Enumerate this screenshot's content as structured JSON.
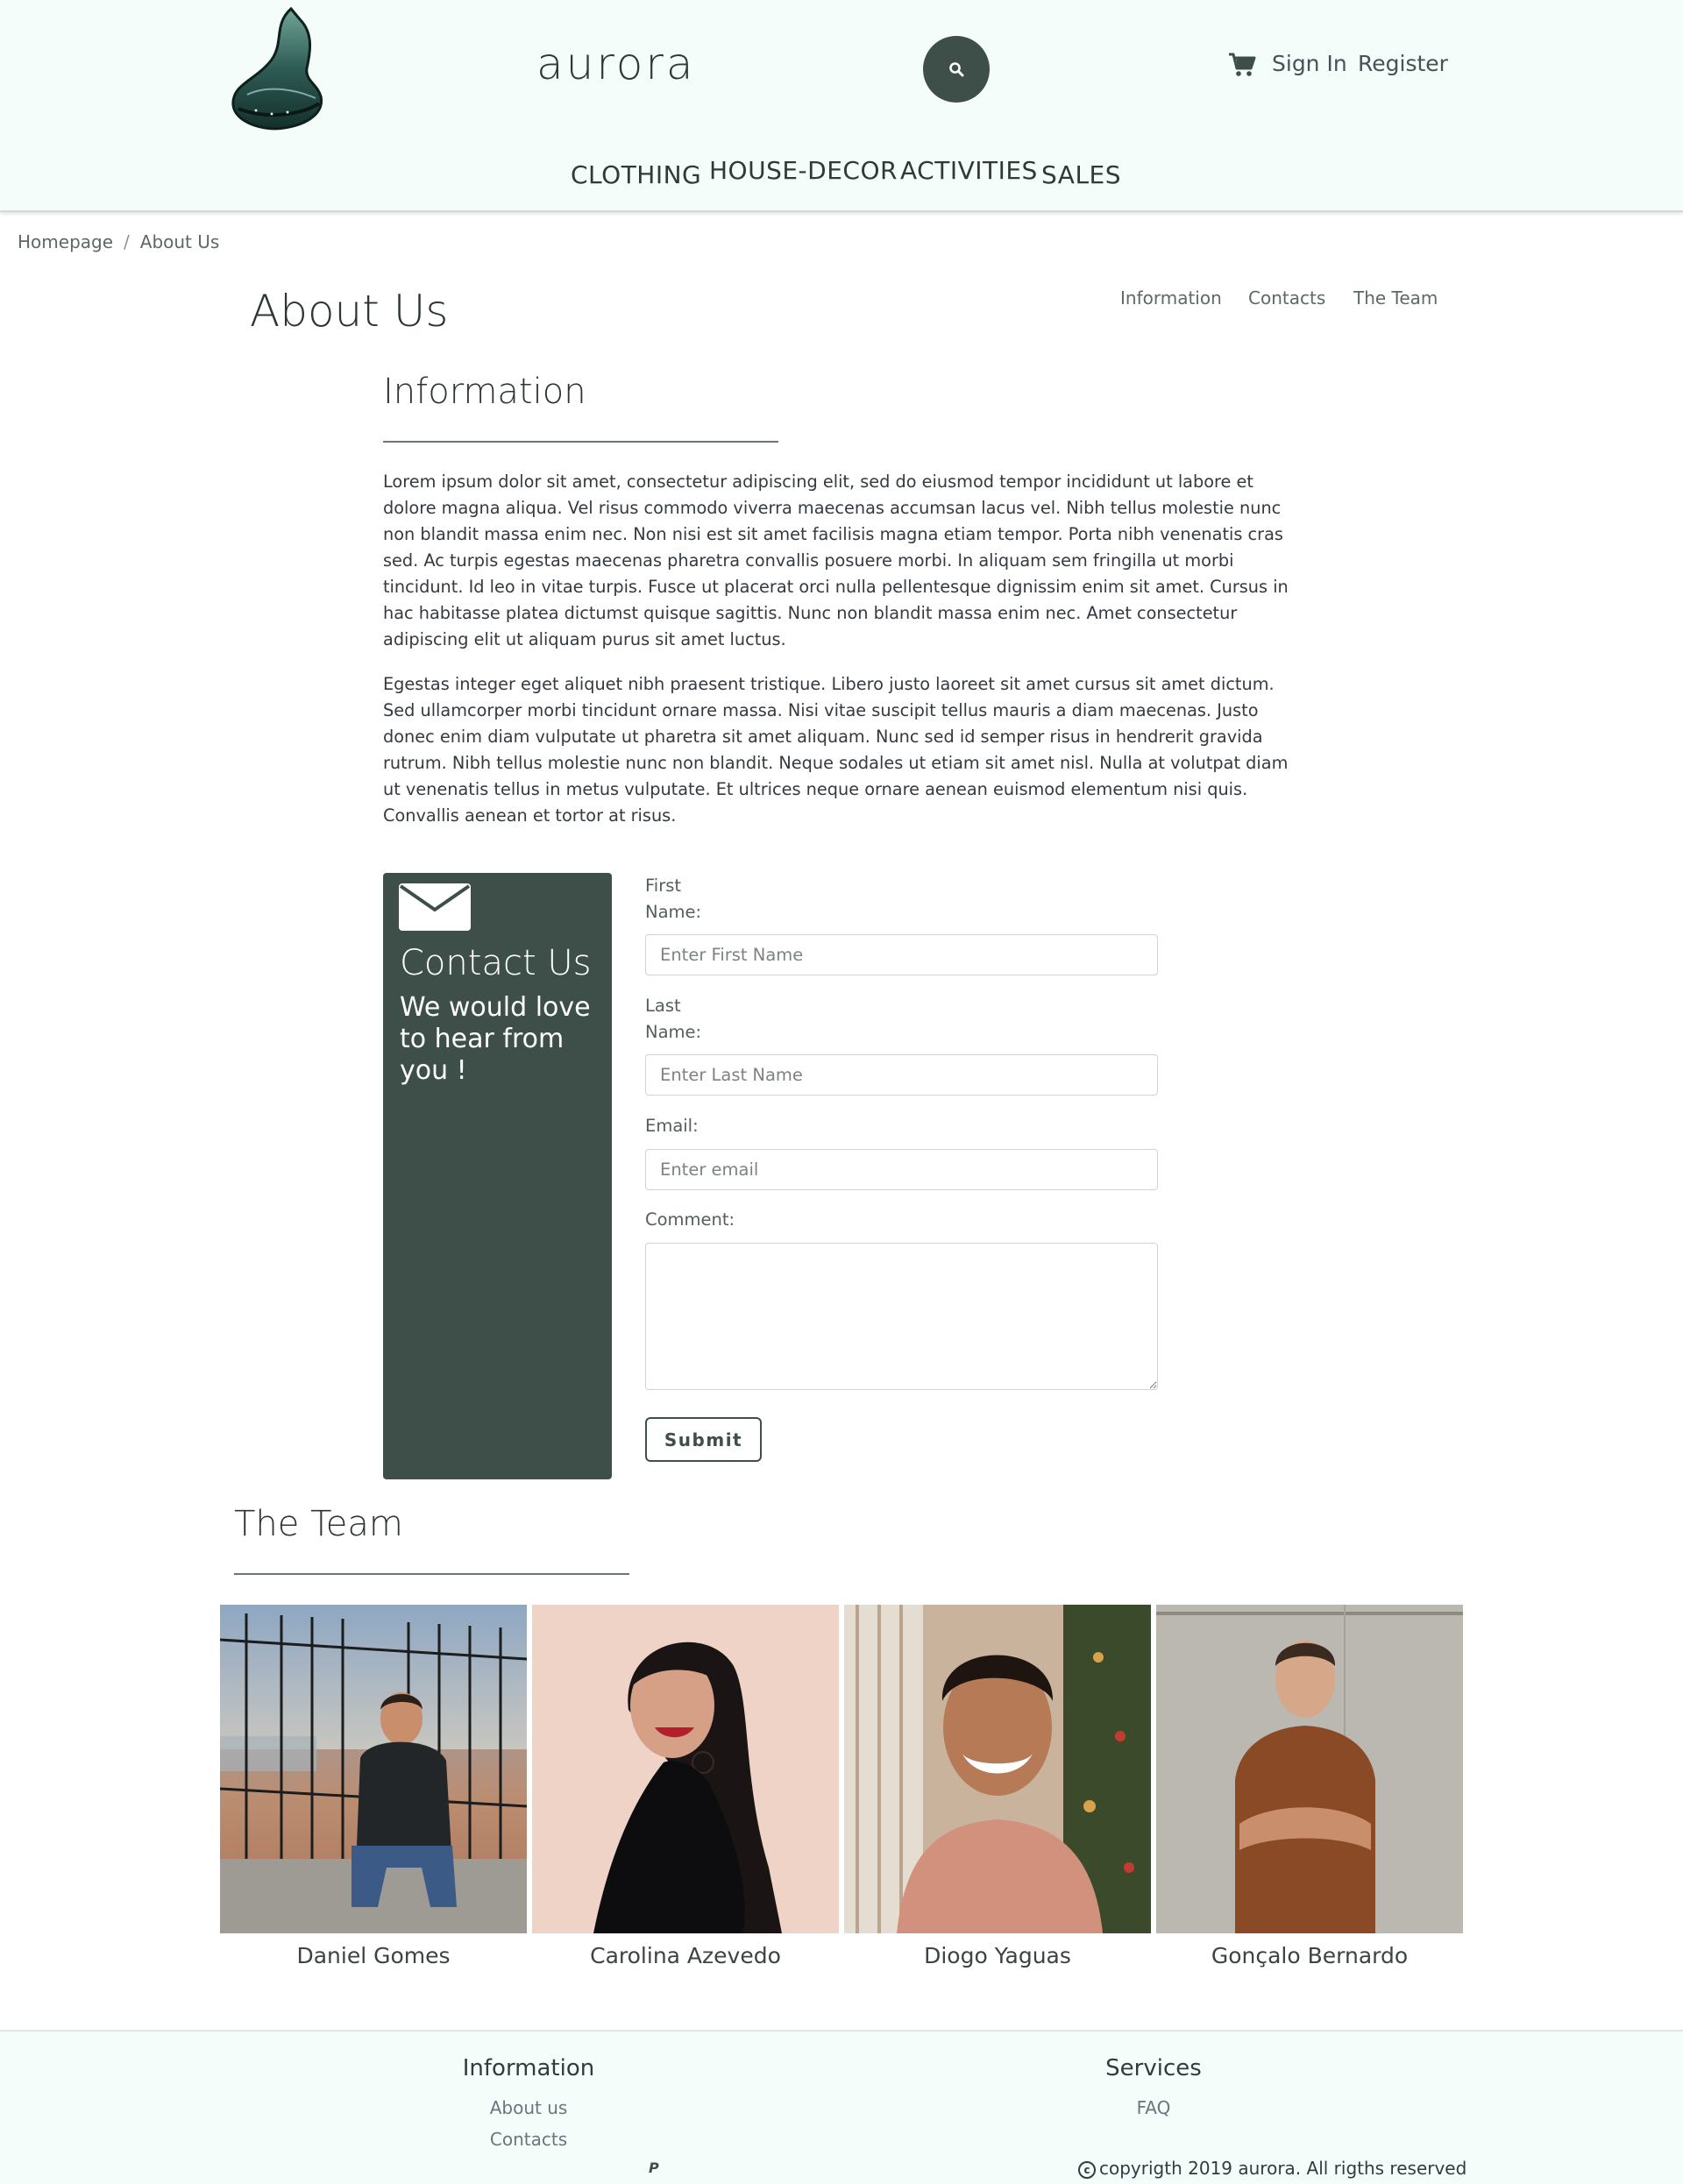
{
  "header": {
    "brand": "aurora",
    "sign_in": "Sign In",
    "register": "Register",
    "nav": [
      "CLOTHING",
      "HOUSE-DECOR",
      "ACTIVITIES",
      "SALES"
    ]
  },
  "breadcrumb": {
    "home": "Homepage",
    "separator": "/",
    "current": "About Us"
  },
  "page": {
    "title": "About Us",
    "subnav": [
      "Information",
      "Contacts",
      "The Team"
    ]
  },
  "information": {
    "title": "Information",
    "paragraphs": [
      "Lorem ipsum dolor sit amet, consectetur adipiscing elit, sed do eiusmod tempor incididunt ut labore et dolore magna aliqua. Vel risus commodo viverra maecenas accumsan lacus vel. Nibh tellus molestie nunc non blandit massa enim nec. Non nisi est sit amet facilisis magna etiam tempor. Porta nibh venenatis cras sed. Ac turpis egestas maecenas pharetra convallis posuere morbi. In aliquam sem fringilla ut morbi tincidunt. Id leo in vitae turpis. Fusce ut placerat orci nulla pellentesque dignissim enim sit amet. Cursus in hac habitasse platea dictumst quisque sagittis. Nunc non blandit massa enim nec. Amet consectetur adipiscing elit ut aliquam purus sit amet luctus.",
      "Egestas integer eget aliquet nibh praesent tristique. Libero justo laoreet sit amet cursus sit amet dictum. Sed ullamcorper morbi tincidunt ornare massa. Nisi vitae suscipit tellus mauris a diam maecenas. Justo donec enim diam vulputate ut pharetra sit amet aliquam. Nunc sed id semper risus in hendrerit gravida rutrum. Nibh tellus molestie nunc non blandit. Neque sodales ut etiam sit amet nisl. Nulla at volutpat diam ut venenatis tellus in metus vulputate. Et ultrices neque ornare aenean euismod elementum nisi quis. Convallis aenean et tortor at risus."
    ]
  },
  "contact": {
    "title": "Contact Us",
    "subtitle": "We would love to hear from you !",
    "first_name_label_1": "First",
    "first_name_label_2": "Name:",
    "first_name_placeholder": "Enter First Name",
    "last_name_label_1": "Last",
    "last_name_label_2": "Name:",
    "last_name_placeholder": "Enter Last Name",
    "email_label": "Email:",
    "email_placeholder": "Enter email",
    "comment_label": "Comment:",
    "submit": "Submit"
  },
  "team": {
    "title": "The Team",
    "members": [
      "Daniel Gomes",
      "Carolina Azevedo",
      "Diogo Yaguas",
      "Gonçalo Bernardo"
    ]
  },
  "footer": {
    "information_heading": "Information",
    "about_link": "About us",
    "contacts_link": "Contacts",
    "services_heading": "Services",
    "faq_link": "FAQ",
    "paypal": "P",
    "copyright": "copyrigth 2019 aurora. All rigths reserved"
  },
  "colors": {
    "accent": "#3e4f49",
    "header_bg": "#f4fdf9"
  }
}
